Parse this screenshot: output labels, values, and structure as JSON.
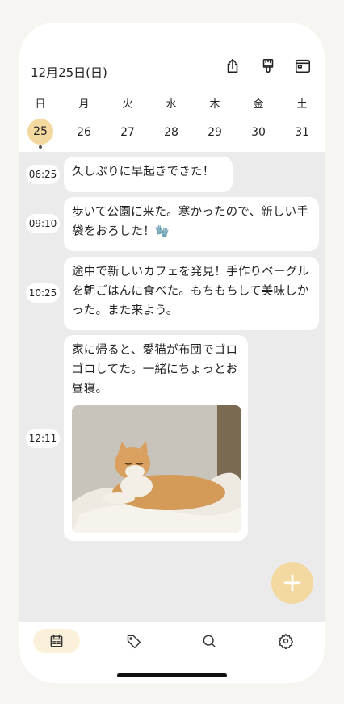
{
  "header": {
    "date": "12月25日(日)"
  },
  "icons": {
    "share": "share-icon",
    "brush": "brush-icon",
    "calendar": "calendar-window-icon"
  },
  "week": {
    "weekdays": [
      "日",
      "月",
      "火",
      "水",
      "木",
      "金",
      "土"
    ],
    "days": [
      "25",
      "26",
      "27",
      "28",
      "29",
      "30",
      "31"
    ],
    "selected_index": 0
  },
  "entries": [
    {
      "time": "06:25",
      "text": "久しぶりに早起きできた！"
    },
    {
      "time": "09:10",
      "text": "歩いて公園に来た。寒かったので、新しい手袋をおろした！🧤"
    },
    {
      "time": "10:25",
      "text": "途中で新しいカフェを発見！手作りベーグルを朝ごはんに食べた。もちもちして美味しかった。また来よう。"
    },
    {
      "time": "12:11",
      "text": "家に帰ると、愛猫が布団でゴロゴロしてた。一緒にちょっとお昼寝。",
      "photo": "cat-on-blanket-photo"
    }
  ],
  "fab": {
    "label": "+"
  },
  "tabs": [
    "calendar-icon",
    "tag-icon",
    "search-icon",
    "gear-icon"
  ],
  "colors": {
    "accent": "#f3d9a0",
    "feed_bg": "#ebebeb"
  }
}
